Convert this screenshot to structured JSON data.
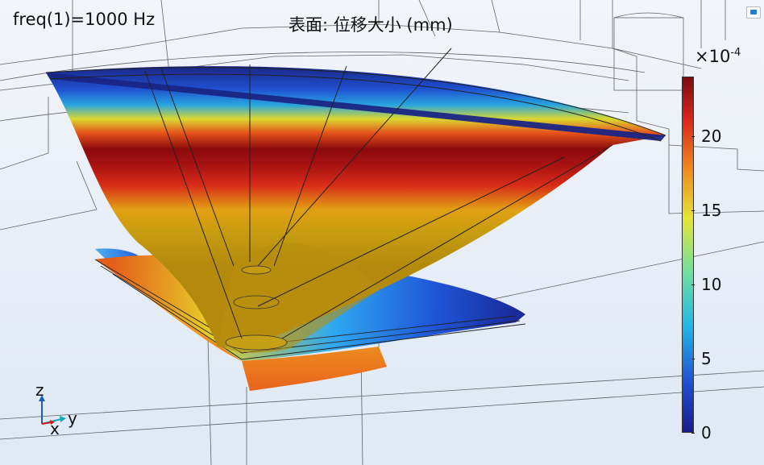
{
  "plot": {
    "freq_label": "freq(1)=1000 Hz",
    "surface_label": "表面: 位移大小 (mm)",
    "exponent_label": "×10",
    "exponent_power": "-4"
  },
  "colorbar": {
    "min": 0,
    "max": 24,
    "ticks": [
      "0",
      "5",
      "10",
      "15",
      "20"
    ],
    "colormap": [
      "#1a1a8c",
      "#1f4fd0",
      "#22b7e6",
      "#6fe0a0",
      "#e4e43a",
      "#f08a1c",
      "#d8261a",
      "#7a0a10"
    ]
  },
  "axes": {
    "z": "z",
    "y": "y",
    "x": "x",
    "z_color": "#1d5fb0",
    "y_color": "#11a8b8",
    "x_color": "#d11a1a"
  },
  "icons": {
    "corner": "view-icon"
  }
}
